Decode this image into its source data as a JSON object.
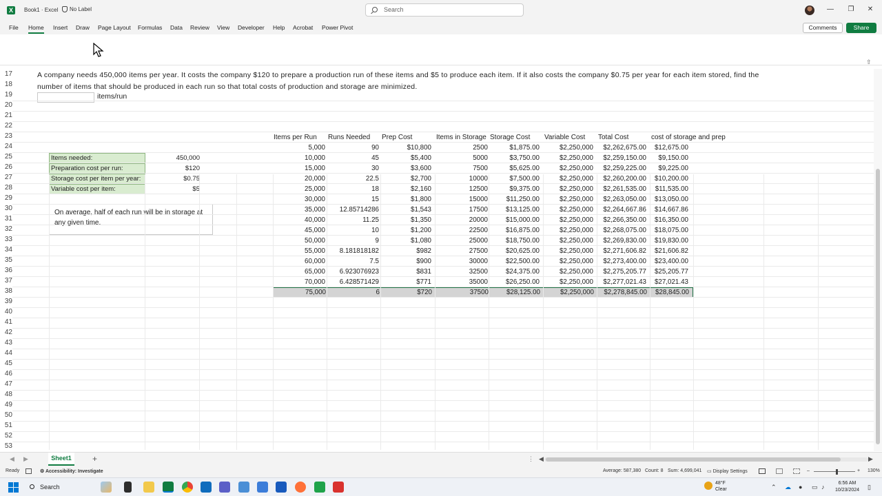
{
  "window": {
    "book_title": "Book1 · Excel",
    "sensitivity_label": "No Label",
    "search_placeholder": "Search"
  },
  "menu": {
    "tabs": [
      "File",
      "Home",
      "Insert",
      "Draw",
      "Page Layout",
      "Formulas",
      "Data",
      "Review",
      "View",
      "Developer",
      "Help",
      "Acrobat",
      "Power Pivot"
    ],
    "active_tab": "Home",
    "comments_label": "Comments",
    "share_label": "Share"
  },
  "row_numbers": [
    "17",
    "18",
    "19",
    "20",
    "21",
    "22",
    "23",
    "24",
    "25",
    "26",
    "27",
    "28",
    "29",
    "30",
    "31",
    "32",
    "33",
    "34",
    "35",
    "36",
    "37",
    "38",
    "39",
    "40",
    "41",
    "42",
    "43",
    "44",
    "45",
    "46",
    "47",
    "48",
    "49",
    "50",
    "51",
    "52",
    "53"
  ],
  "problem": {
    "line1": "A company needs 450,000 items per year. It costs the company $120 to prepare a production run of these items and $5 to produce each item. If it also costs the company $0.75 per year for each item stored, find the",
    "line2": "number of items that should be produced in each run so that total costs of production and storage are minimized.",
    "answer_unit": "items/run"
  },
  "parameters": [
    {
      "label": "Items needed:",
      "value": "450,000"
    },
    {
      "label": "Preparation cost per run:",
      "value": "$120"
    },
    {
      "label": "Storage cost per item per year:",
      "value": "$0.75"
    },
    {
      "label": "Variable cost per item:",
      "value": "$5"
    }
  ],
  "note": "On average, half of each run will be in storage at any given time.",
  "table": {
    "headers": [
      "Items per Run",
      "Runs Needed",
      "Prep Cost",
      "Items in Storage",
      "Storage Cost",
      "Variable Cost",
      "Total Cost",
      "cost of storage and prep"
    ],
    "rows": [
      [
        "5,000",
        "90",
        "$10,800",
        "2500",
        "$1,875.00",
        "$2,250,000",
        "$2,262,675.00",
        "$12,675.00"
      ],
      [
        "10,000",
        "45",
        "$5,400",
        "5000",
        "$3,750.00",
        "$2,250,000",
        "$2,259,150.00",
        "$9,150.00"
      ],
      [
        "15,000",
        "30",
        "$3,600",
        "7500",
        "$5,625.00",
        "$2,250,000",
        "$2,259,225.00",
        "$9,225.00"
      ],
      [
        "20,000",
        "22.5",
        "$2,700",
        "10000",
        "$7,500.00",
        "$2,250,000",
        "$2,260,200.00",
        "$10,200.00"
      ],
      [
        "25,000",
        "18",
        "$2,160",
        "12500",
        "$9,375.00",
        "$2,250,000",
        "$2,261,535.00",
        "$11,535.00"
      ],
      [
        "30,000",
        "15",
        "$1,800",
        "15000",
        "$11,250.00",
        "$2,250,000",
        "$2,263,050.00",
        "$13,050.00"
      ],
      [
        "35,000",
        "12.85714286",
        "$1,543",
        "17500",
        "$13,125.00",
        "$2,250,000",
        "$2,264,667.86",
        "$14,667.86"
      ],
      [
        "40,000",
        "11.25",
        "$1,350",
        "20000",
        "$15,000.00",
        "$2,250,000",
        "$2,266,350.00",
        "$16,350.00"
      ],
      [
        "45,000",
        "10",
        "$1,200",
        "22500",
        "$16,875.00",
        "$2,250,000",
        "$2,268,075.00",
        "$18,075.00"
      ],
      [
        "50,000",
        "9",
        "$1,080",
        "25000",
        "$18,750.00",
        "$2,250,000",
        "$2,269,830.00",
        "$19,830.00"
      ],
      [
        "55,000",
        "8.181818182",
        "$982",
        "27500",
        "$20,625.00",
        "$2,250,000",
        "$2,271,606.82",
        "$21,606.82"
      ],
      [
        "60,000",
        "7.5",
        "$900",
        "30000",
        "$22,500.00",
        "$2,250,000",
        "$2,273,400.00",
        "$23,400.00"
      ],
      [
        "65,000",
        "6.923076923",
        "$831",
        "32500",
        "$24,375.00",
        "$2,250,000",
        "$2,275,205.77",
        "$25,205.77"
      ],
      [
        "70,000",
        "6.428571429",
        "$771",
        "35000",
        "$26,250.00",
        "$2,250,000",
        "$2,277,021.43",
        "$27,021.43"
      ],
      [
        "75,000",
        "6",
        "$720",
        "37500",
        "$28,125.00",
        "$2,250,000",
        "$2,278,845.00",
        "$28,845.00"
      ]
    ],
    "selected_row_index": 14
  },
  "sheets": {
    "active": "Sheet1",
    "add_label": "+"
  },
  "status": {
    "ready": "Ready",
    "accessibility": "Accessibility: Investigate",
    "average": "Average: 587,380",
    "count": "Count: 8",
    "sum": "Sum: 4,699,041",
    "display_settings": "Display Settings",
    "zoom": "130%"
  },
  "taskbar": {
    "search_label": "Search",
    "weather_temp": "48°F",
    "weather_desc": "Clear",
    "time": "6:56 AM",
    "date": "10/23/2024"
  },
  "colors": {
    "excel_green": "#107c41",
    "param_fill": "#d9ecd0",
    "selection_fill": "#d4d4d4"
  }
}
